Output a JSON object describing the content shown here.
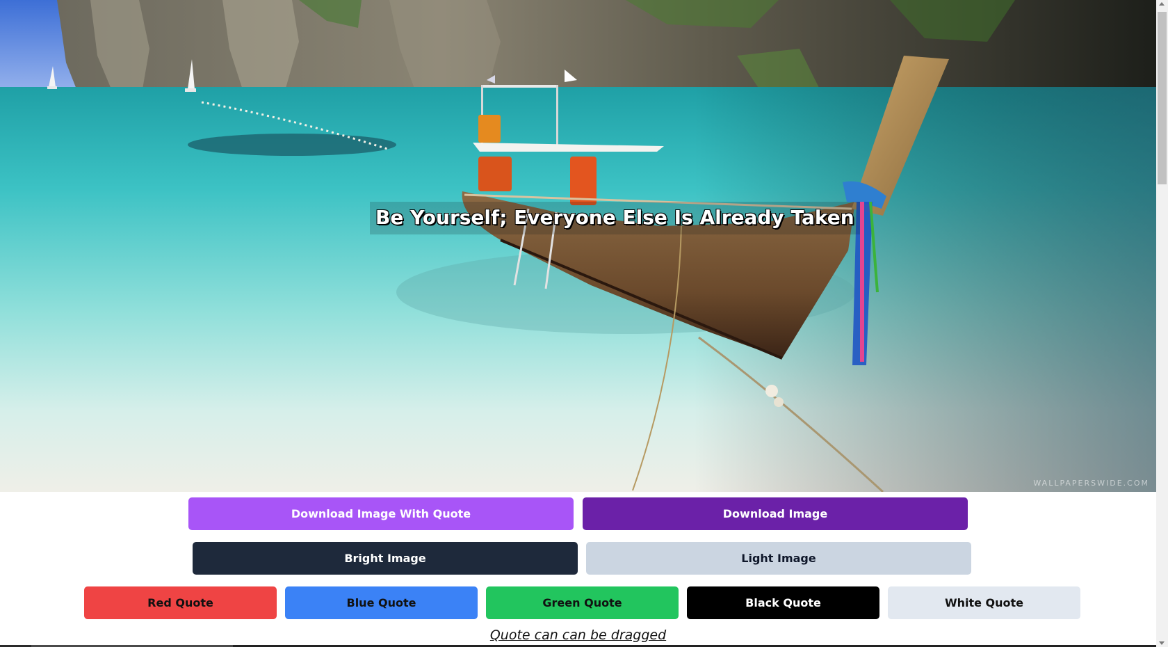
{
  "hero": {
    "quote": "Be Yourself; Everyone Else Is Already Taken",
    "watermark": "WALLPAPERSWIDE.COM"
  },
  "buttons": {
    "download_with_quote": "Download Image With Quote",
    "download_image": "Download Image",
    "bright_image": "Bright Image",
    "light_image": "Light Image",
    "red_quote": "Red Quote",
    "blue_quote": "Blue Quote",
    "green_quote": "Green Quote",
    "black_quote": "Black Quote",
    "white_quote": "White Quote"
  },
  "hint": "Quote can can be dragged",
  "colors": {
    "download_with_quote": "#a855f7",
    "download_image": "#6b21a8",
    "bright_image": "#1e293b",
    "light_image": "#cbd5e1",
    "red_quote": "#ef4444",
    "blue_quote": "#3b82f6",
    "green_quote": "#22c55e",
    "black_quote": "#000000",
    "white_quote": "#e2e8f0"
  }
}
